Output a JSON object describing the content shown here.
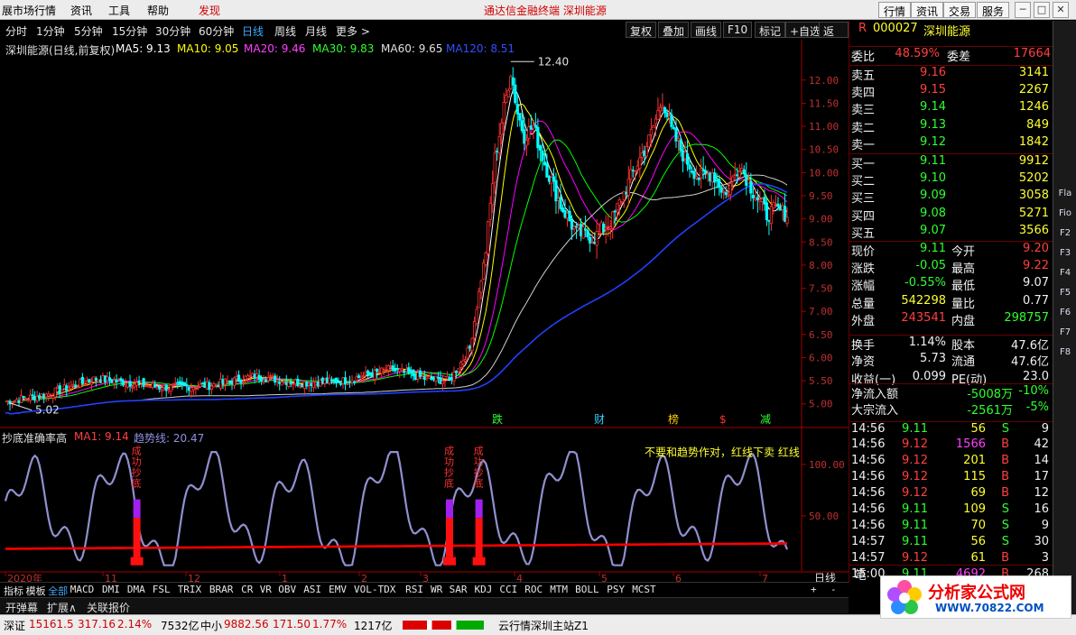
{
  "menu": {
    "items": [
      "展市场行情",
      "资讯",
      "工具",
      "帮助",
      "发现"
    ],
    "center_title": "通达信金融终端   深圳能源",
    "right_buttons": [
      "行情",
      "资讯",
      "交易",
      "服务"
    ]
  },
  "period_bar": {
    "periods": [
      "分时",
      "1分钟",
      "5分钟",
      "15分钟",
      "30分钟",
      "60分钟",
      "日线",
      "周线",
      "月线",
      "更多 >"
    ],
    "selected": "日线",
    "tools": [
      "复权",
      "叠加",
      "画线",
      "F10",
      "标记",
      "+自选",
      "返回"
    ]
  },
  "main_legend": {
    "title": "深圳能源(日线,前复权)",
    "ma5": "MA5: 9.13",
    "ma10": "MA10: 9.05",
    "ma20": "MA20: 9.46",
    "ma30": "MA30: 9.83",
    "ma60": "MA60: 9.65",
    "ma120": "MA120: 8.51"
  },
  "annotations": {
    "high": "12.40",
    "low": "5.02",
    "events": [
      "跌",
      "财",
      "榜",
      "$",
      "减"
    ]
  },
  "indicator": {
    "title": "抄底准确率高",
    "ma1": "MA1: 9.14",
    "trend": "趋势线: 20.47",
    "scale": [
      "100.00",
      "50.00"
    ],
    "signal_text": "成功抄底",
    "note": "不要和趋势作对，红线下卖 红线"
  },
  "time_axis": {
    "labels": [
      "2020年",
      "11",
      "12",
      "1",
      "2",
      "3",
      "4",
      "5",
      "6",
      "7"
    ],
    "period_label": "日线"
  },
  "indicator_tabs": {
    "items": [
      "指标",
      "模板",
      "全部",
      "MACD",
      "DMI",
      "DMA",
      "FSL",
      "TRIX",
      "BRAR",
      "CR",
      "VR",
      "OBV",
      "ASI",
      "EMV",
      "VOL-TDX",
      "RSI",
      "WR",
      "SAR",
      "KDJ",
      "CCI",
      "ROC",
      "MTM",
      "BOLL",
      "PSY",
      "MCST"
    ],
    "selected": "全部",
    "right": [
      "+",
      "-"
    ]
  },
  "bottom_tabs": [
    "开弹幕",
    "扩展∧",
    "关联报价"
  ],
  "status_bar": {
    "sz_label": "深证",
    "sz_value": "15161.5",
    "sz_change": "317.16",
    "sz_pct": "2.14%",
    "sz_amount": "7532亿",
    "zx_label": "中小",
    "zx_value": "9882.56",
    "zx_change": "171.50",
    "zx_pct": "1.77%",
    "zx_amount": "1217亿",
    "server": "云行情深圳主站Z1"
  },
  "quote": {
    "code": "000027",
    "name": "深圳能源",
    "r_badge": "R",
    "webi_label": "委比",
    "webi_value": "48.59%",
    "weicha_label": "委差",
    "weicha_value": "17664",
    "asks": [
      {
        "label": "卖五",
        "price": "9.16",
        "vol": "3141"
      },
      {
        "label": "卖四",
        "price": "9.15",
        "vol": "2267"
      },
      {
        "label": "卖三",
        "price": "9.14",
        "vol": "1246"
      },
      {
        "label": "卖二",
        "price": "9.13",
        "vol": "849"
      },
      {
        "label": "卖一",
        "price": "9.12",
        "vol": "1842"
      }
    ],
    "bids": [
      {
        "label": "买一",
        "price": "9.11",
        "vol": "9912"
      },
      {
        "label": "买二",
        "price": "9.10",
        "vol": "5202"
      },
      {
        "label": "买三",
        "price": "9.09",
        "vol": "3058"
      },
      {
        "label": "买四",
        "price": "9.08",
        "vol": "5271"
      },
      {
        "label": "买五",
        "price": "9.07",
        "vol": "3566"
      }
    ],
    "stats": [
      [
        "现价",
        "9.11",
        "今开",
        "9.20"
      ],
      [
        "涨跌",
        "-0.05",
        "最高",
        "9.22"
      ],
      [
        "涨幅",
        "-0.55%",
        "最低",
        "9.07"
      ],
      [
        "总量",
        "542298",
        "量比",
        "0.77"
      ],
      [
        "外盘",
        "243541",
        "内盘",
        "298757"
      ],
      [
        "换手",
        "1.14%",
        "股本",
        "47.6亿"
      ],
      [
        "净资",
        "5.73",
        "流通",
        "47.6亿"
      ],
      [
        "收益(一)",
        "0.099",
        "PE(动)",
        "23.0"
      ]
    ],
    "net_inflow_label": "净流入额",
    "net_inflow_value": "-5008万",
    "net_inflow_pct": "-10%",
    "block_inflow_label": "大宗流入",
    "block_inflow_value": "-2561万",
    "block_inflow_pct": "-5%",
    "ticks": [
      [
        "14:56",
        "9.11",
        "56",
        "S",
        "9"
      ],
      [
        "14:56",
        "9.12",
        "1566",
        "B",
        "42"
      ],
      [
        "14:56",
        "9.12",
        "201",
        "B",
        "14"
      ],
      [
        "14:56",
        "9.12",
        "115",
        "B",
        "17"
      ],
      [
        "14:56",
        "9.12",
        "69",
        "B",
        "12"
      ],
      [
        "14:56",
        "9.11",
        "109",
        "S",
        "16"
      ],
      [
        "14:56",
        "9.11",
        "70",
        "S",
        "9"
      ],
      [
        "14:57",
        "9.11",
        "56",
        "S",
        "30"
      ],
      [
        "14:57",
        "9.12",
        "61",
        "B",
        "3"
      ],
      [
        "15:00",
        "9.11",
        "4692",
        "B",
        "268"
      ]
    ],
    "bottom_label": "笔"
  },
  "right_side_tabs": [
    "Fla",
    "Fio",
    "F2",
    "F3",
    "F4",
    "F5",
    "F6",
    "F7",
    "F8"
  ],
  "logo": {
    "name": "分析家公式网",
    "url": "WWW.70822.COM"
  },
  "colors": {
    "up": "#ff3030",
    "down": "#00ffff",
    "ma5": "#ffffff",
    "ma10": "#ffff00",
    "ma20": "#ff00ff",
    "ma30": "#00ff00",
    "ma60": "#d0d0d0",
    "ma120": "#2040ff",
    "indicator": "#9090d0",
    "trend": "#ff0000"
  },
  "chart_data": {
    "type": "candlestick",
    "ylim": [
      4.8,
      12.6
    ],
    "y_ticks": [
      5.0,
      5.5,
      6.0,
      6.5,
      7.0,
      7.5,
      8.0,
      8.5,
      9.0,
      9.5,
      10.0,
      10.5,
      11.0,
      11.5,
      12.0
    ],
    "high": 12.4,
    "low": 5.02,
    "last": 9.11,
    "indicator_ylim": [
      0,
      120
    ],
    "indicator_ticks": [
      50,
      100
    ],
    "signal_bars": [
      58,
      196,
      209
    ]
  }
}
